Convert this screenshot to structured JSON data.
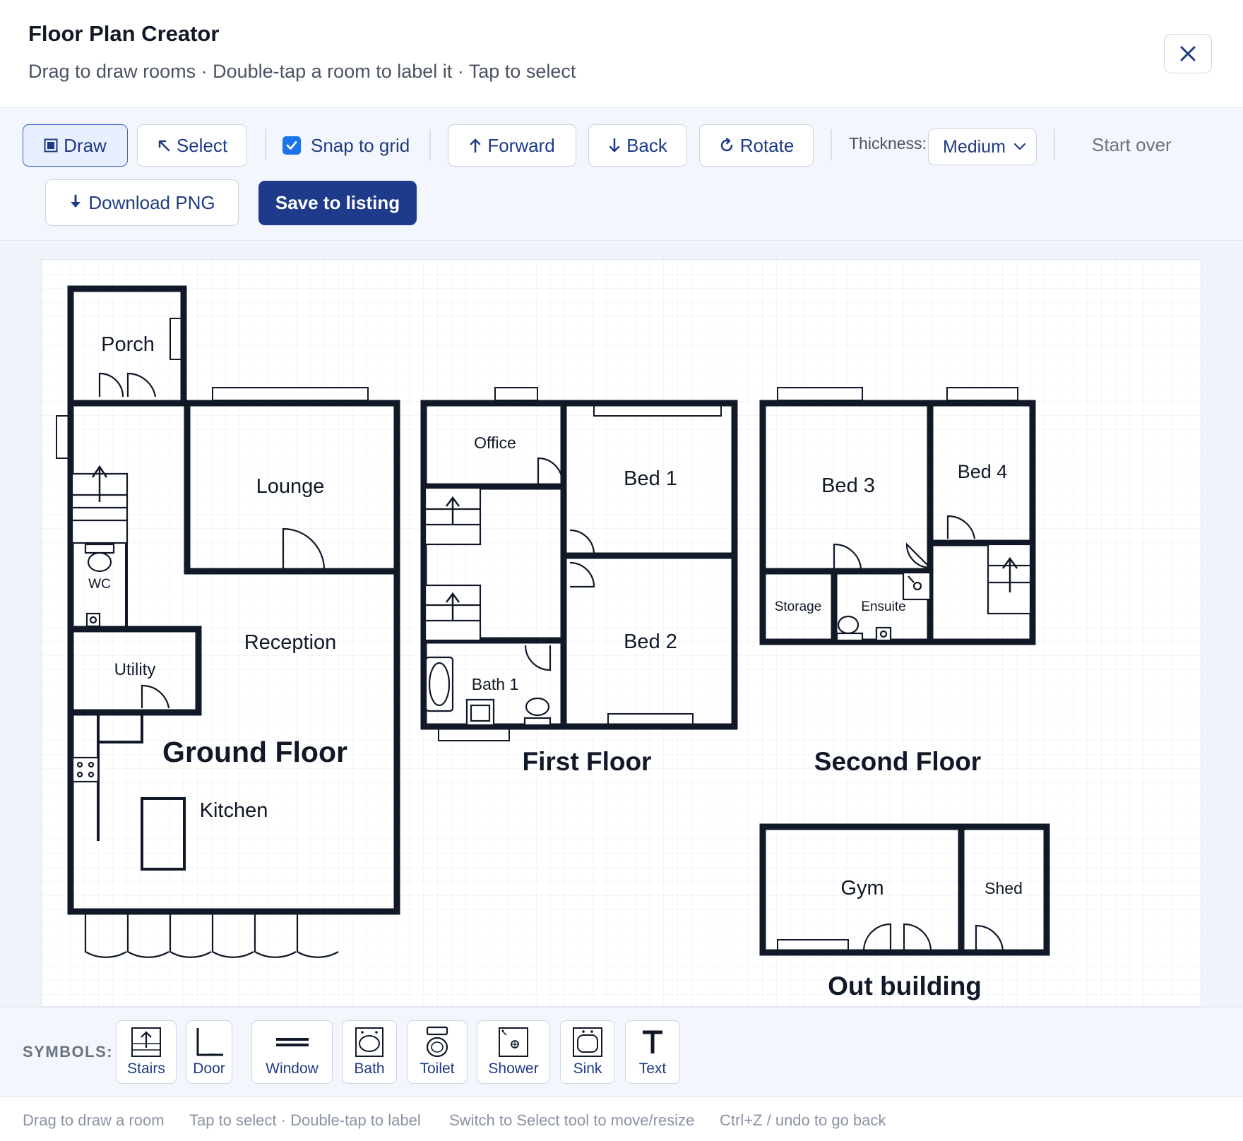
{
  "header": {
    "title": "Floor Plan Creator",
    "subtitle": "Drag to draw rooms · Double-tap a room to label it · Tap to select"
  },
  "toolbar": {
    "draw": "Draw",
    "select": "Select",
    "snap": "Snap to grid",
    "snap_checked": true,
    "forward": "Forward",
    "back": "Back",
    "rotate": "Rotate",
    "thickness_label": "Thickness:",
    "thickness_value": "Medium",
    "start_over": "Start over",
    "download": "Download PNG",
    "save": "Save to listing"
  },
  "plan": {
    "rooms": {
      "porch": "Porch",
      "lounge": "Lounge",
      "wc": "WC",
      "reception": "Reception",
      "utility": "Utility",
      "kitchen": "Kitchen",
      "office": "Office",
      "bed1": "Bed 1",
      "bed2": "Bed 2",
      "bath1": "Bath 1",
      "bed3": "Bed 3",
      "bed4": "Bed 4",
      "storage": "Storage",
      "ensuite": "Ensuite",
      "gym": "Gym",
      "shed": "Shed"
    },
    "floors": {
      "ground": "Ground Floor",
      "first": "First Floor",
      "second": "Second Floor",
      "out": "Out building"
    }
  },
  "symbols": {
    "label": "SYMBOLS:",
    "items": [
      "Stairs",
      "Door",
      "Window",
      "Bath",
      "Toilet",
      "Shower",
      "Sink",
      "Text"
    ]
  },
  "footer": {
    "hints": [
      "Drag to draw a room",
      "Tap to select · Double-tap to label",
      "Switch to Select tool to move/resize",
      "Ctrl+Z / undo to go back"
    ]
  },
  "colors": {
    "accent": "#1e3a8a",
    "wall": "#111827",
    "grid": "#e6ebf3"
  }
}
